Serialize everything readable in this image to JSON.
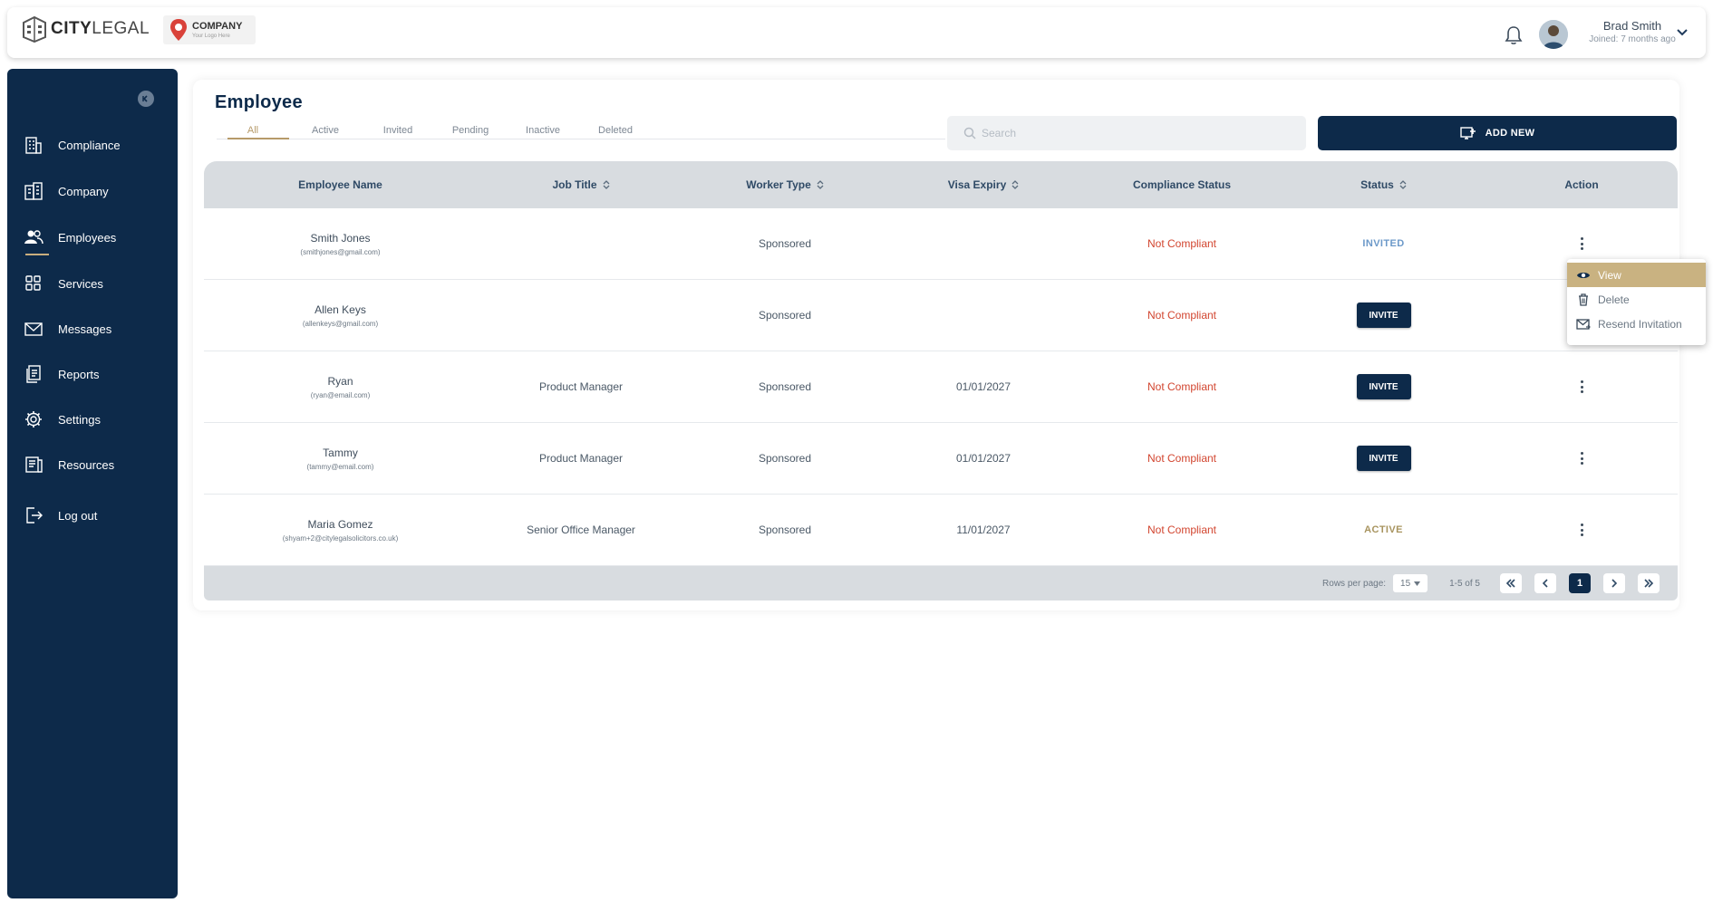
{
  "header": {
    "brand_bold": "CITY",
    "brand_light": "LEGAL",
    "company_logo_title": "COMPANY",
    "company_logo_sub": "Your Logo Here",
    "user_name": "Brad Smith",
    "user_joined": "Joined: 7 months ago"
  },
  "sidebar": {
    "items": [
      {
        "label": "Compliance",
        "icon": "building-icon"
      },
      {
        "label": "Company",
        "icon": "office-icon"
      },
      {
        "label": "Employees",
        "icon": "users-icon"
      },
      {
        "label": "Services",
        "icon": "grid-icon"
      },
      {
        "label": "Messages",
        "icon": "envelope-icon"
      },
      {
        "label": "Reports",
        "icon": "documents-icon"
      },
      {
        "label": "Settings",
        "icon": "gear-icon"
      },
      {
        "label": "Resources",
        "icon": "book-icon"
      },
      {
        "label": "Log out",
        "icon": "logout-icon"
      }
    ],
    "active": "Employees"
  },
  "page": {
    "title": "Employee",
    "tabs": [
      "All",
      "Active",
      "Invited",
      "Pending",
      "Inactive",
      "Deleted"
    ],
    "active_tab": "All",
    "search_placeholder": "Search",
    "add_button": "ADD NEW"
  },
  "table": {
    "columns": [
      "Employee Name",
      "Job Title",
      "Worker Type",
      "Visa Expiry",
      "Compliance Status",
      "Status",
      "Action"
    ],
    "rows": [
      {
        "name": "Smith Jones",
        "email": "(smithjones@gmail.com)",
        "job": "",
        "worker": "Sponsored",
        "visa": "",
        "compliance": "Not Compliant",
        "status": "INVITED"
      },
      {
        "name": "Allen Keys",
        "email": "(allenkeys@gmail.com)",
        "job": "",
        "worker": "Sponsored",
        "visa": "",
        "compliance": "Not Compliant",
        "status": "INVITE"
      },
      {
        "name": "Ryan",
        "email": "(ryan@email.com)",
        "job": "Product Manager",
        "worker": "Sponsored",
        "visa": "01/01/2027",
        "compliance": "Not Compliant",
        "status": "INVITE"
      },
      {
        "name": "Tammy",
        "email": "(tammy@email.com)",
        "job": "Product Manager",
        "worker": "Sponsored",
        "visa": "01/01/2027",
        "compliance": "Not Compliant",
        "status": "INVITE"
      },
      {
        "name": "Maria Gomez",
        "email": "(shyam+2@citylegalsolicitors.co.uk)",
        "job": "Senior Office Manager",
        "worker": "Sponsored",
        "visa": "11/01/2027",
        "compliance": "Not Compliant",
        "status": "ACTIVE"
      }
    ]
  },
  "pagination": {
    "rows_per_page_label": "Rows per page:",
    "rows_per_page": "15",
    "range": "1-5 of 5",
    "current_page": "1"
  },
  "action_menu": {
    "items": [
      "View",
      "Delete",
      "Resend Invitation"
    ]
  },
  "colors": {
    "navy": "#0d2a4a",
    "gold": "#b69a69",
    "not_compliant": "#d2452f"
  }
}
